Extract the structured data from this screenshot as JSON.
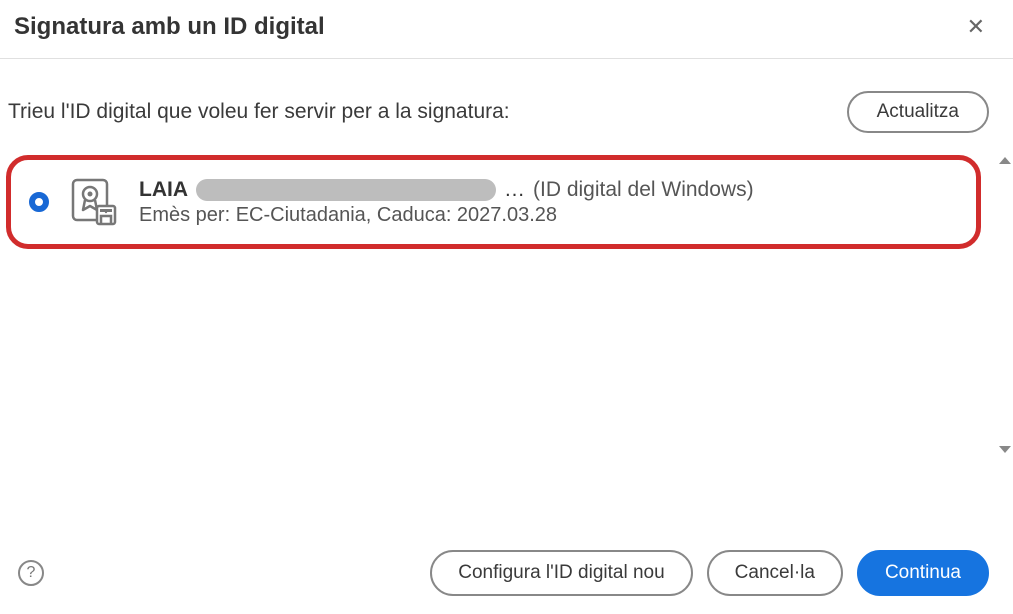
{
  "header": {
    "title": "Signatura amb un ID digital"
  },
  "prompt": "Trieu l'ID digital que voleu fer servir per a la signatura:",
  "buttons": {
    "refresh": "Actualitza",
    "configure": "Configura l'ID digital nou",
    "cancel": "Cancel·la",
    "continue": "Continua"
  },
  "items": [
    {
      "selected": true,
      "name": "LAIA",
      "ellipsis": "…",
      "type_suffix": "(ID digital del Windows)",
      "issuer_line": "Emès per: EC-Ciutadania, Caduca: 2027.03.28"
    }
  ]
}
